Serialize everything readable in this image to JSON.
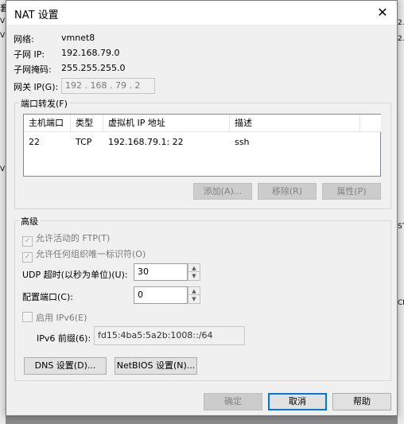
{
  "dialog": {
    "title": "NAT 设置",
    "close_glyph": "✕"
  },
  "info": {
    "network_label": "网络:",
    "network_value": "vmnet8",
    "subnet_ip_label": "子网 IP:",
    "subnet_ip_value": "192.168.79.0",
    "subnet_mask_label": "子网掩码:",
    "subnet_mask_value": "255.255.255.0",
    "gateway_label": "网关 IP(G):",
    "gateway_value": "192 . 168 . 79 . 2"
  },
  "port_forwarding": {
    "title": "端口转发(F)",
    "columns": [
      "主机端口",
      "类型",
      "虚拟机 IP 地址",
      "描述"
    ],
    "rows": [
      {
        "host_port": "22",
        "type": "TCP",
        "vm_ip": "192.168.79.1: 22",
        "description": "ssh"
      }
    ],
    "add_button": "添加(A)...",
    "remove_button": "移除(R)",
    "properties_button": "属性(P)"
  },
  "advanced": {
    "title": "高级",
    "allow_ftp": "允许活动的 FTP(T)",
    "allow_uid": "允许任何组织唯一标识符(O)",
    "udp_timeout_label": "UDP 超时(以秒为单位)(U):",
    "udp_timeout_value": "30",
    "config_port_label": "配置端口(C):",
    "config_port_value": "0",
    "enable_ipv6": "启用 IPv6(E)",
    "ipv6_prefix_label": "IPv6 前缀(6):",
    "ipv6_prefix_value": "fd15:4ba5:5a2b:1008::/64",
    "dns_button": "DNS 设置(D)...",
    "netbios_button": "NetBIOS 设置(N)..."
  },
  "footer": {
    "ok": "确定",
    "cancel": "取消",
    "help": "帮助"
  },
  "background": {
    "left_chars": [
      "套",
      "V",
      "V",
      "V"
    ],
    "right_chars": [
      "2.",
      "2.",
      "ST",
      "CF"
    ]
  }
}
